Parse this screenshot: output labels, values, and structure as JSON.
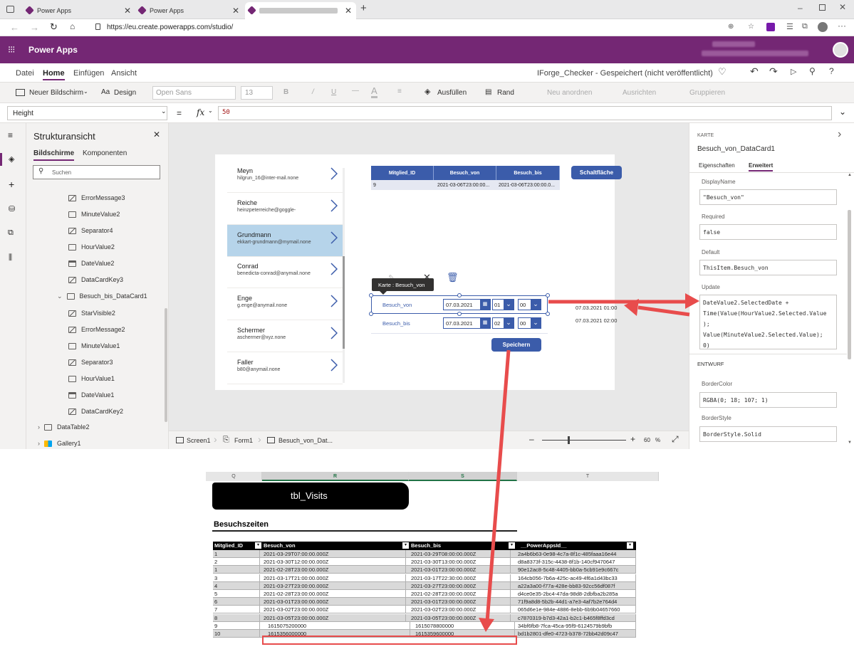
{
  "browser": {
    "tabs": [
      {
        "label": "Power Apps"
      },
      {
        "label": "Power Apps"
      },
      {
        "label": ""
      }
    ],
    "url": "https://eu.create.powerapps.com/studio/"
  },
  "app": {
    "brand": "Power Apps",
    "user_lines": [
      "",
      ""
    ]
  },
  "menu": {
    "items": [
      "Datei",
      "Home",
      "Einfügen",
      "Ansicht"
    ],
    "active": "Home",
    "status": "IForge_Checker - Gespeichert (nicht veröffentlicht)"
  },
  "toolbar": {
    "new_screen": "Neuer Bildschirm",
    "design": "Design",
    "font": "Open Sans",
    "size": "13",
    "fill": "Ausfüllen",
    "border": "Rand",
    "reorder": "Neu anordnen",
    "align": "Ausrichten",
    "group": "Gruppieren"
  },
  "formula": {
    "property": "Height",
    "fx": "fx",
    "value": "50"
  },
  "tree": {
    "title": "Strukturansicht",
    "tab_screens": "Bildschirme",
    "tab_components": "Komponenten",
    "search_placeholder": "Suchen",
    "nodes": [
      {
        "label": "ErrorMessage3",
        "icon": "edit-icon"
      },
      {
        "label": "MinuteValue2",
        "icon": "dropdown-icon"
      },
      {
        "label": "Separator4",
        "icon": "edit-icon"
      },
      {
        "label": "HourValue2",
        "icon": "dropdown-icon"
      },
      {
        "label": "DateValue2",
        "icon": "calendar-icon"
      },
      {
        "label": "DataCardKey3",
        "icon": "edit-icon"
      },
      {
        "label": "Besuch_bis_DataCard1",
        "icon": "card-icon"
      },
      {
        "label": "StarVisible2",
        "icon": "edit-icon"
      },
      {
        "label": "ErrorMessage2",
        "icon": "edit-icon"
      },
      {
        "label": "MinuteValue1",
        "icon": "dropdown-icon"
      },
      {
        "label": "Separator3",
        "icon": "edit-icon"
      },
      {
        "label": "HourValue1",
        "icon": "dropdown-icon"
      },
      {
        "label": "DateValue1",
        "icon": "calendar-icon"
      },
      {
        "label": "DataCardKey2",
        "icon": "edit-icon"
      },
      {
        "label": "DataTable2",
        "icon": "table-icon"
      },
      {
        "label": "Gallery1",
        "icon": "gallery-icon"
      }
    ]
  },
  "gallery": [
    {
      "name": "Meyn",
      "email": "hilgrun_16@inter-mail.none"
    },
    {
      "name": "Reiche",
      "email": "heinzpeterreiche@goggle-"
    },
    {
      "name": "Grundmann",
      "email": "ekkart-grundmann@mymail.none"
    },
    {
      "name": "Conrad",
      "email": "benedicta-conrad@anymail.none"
    },
    {
      "name": "Enge",
      "email": "g.enge@anymail.none"
    },
    {
      "name": "Schermer",
      "email": "aschermer@xyz.none"
    },
    {
      "name": "Faller",
      "email": "b80@anymail.none"
    }
  ],
  "datatable": {
    "headers": [
      "Mitglied_ID",
      "Besuch_von",
      "Besuch_bis"
    ],
    "row": [
      "9",
      "2021-03-06T23:00:00...",
      "2021-03-06T23:00:00.0..."
    ]
  },
  "canvas": {
    "button": "Schaltfläche",
    "tooltip": "Karte : Besuch_von",
    "field1_label": "Besuch_von",
    "field1_date": "07.03.2021",
    "field1_hour": "01",
    "field1_min": "00",
    "field2_label": "Besuch_bis",
    "field2_date": "07.03.2021",
    "field2_hour": "02",
    "field2_min": "00",
    "out1": "07.03.2021 01:00",
    "out2": "07.03.2021 02:00",
    "save": "Speichern"
  },
  "statusbar": {
    "crumbs": [
      "Screen1",
      "Form1",
      "Besuch_von_Dat..."
    ],
    "zoom": "60",
    "zoom_unit": "%"
  },
  "props": {
    "kind": "KARTE",
    "name": "Besuch_von_DataCard1",
    "tab_props": "Eigenschaften",
    "tab_adv": "Erweitert",
    "displayname_label": "DisplayName",
    "displayname": "\"Besuch_von\"",
    "required_label": "Required",
    "required": "false",
    "default_label": "Default",
    "default": "ThisItem.Besuch_von",
    "update_label": "Update",
    "update_lines": [
      "DateValue2.SelectedDate +",
      "Time(Value(HourValue2.Selected.Value",
      ");",
      "Value(MinuteValue2.Selected.Value);",
      "0)"
    ],
    "section": "ENTWURF",
    "bordercolor_label": "BorderColor",
    "bordercolor": "RGBA(0; 18; 107; 1)",
    "borderstyle_label": "BorderStyle",
    "borderstyle": "BorderStyle.Solid"
  },
  "excel": {
    "cols": [
      "Q",
      "R",
      "S",
      "T"
    ],
    "banner": "tbl_Visits",
    "heading": "Besuchszeiten",
    "headers": [
      "Mitglied_ID",
      "Besuch_von",
      "Besuch_bis",
      "__PowerAppsId__"
    ],
    "rows": [
      [
        "1",
        "2021-03-29T07:00:00.000Z",
        "2021-03-29T08:00:00.000Z",
        "2a4b6b63-0e98-4c7a-8f1c-485faaa16e44"
      ],
      [
        "2",
        "2021-03-30T12:00:00.000Z",
        "2021-03-30T13:00:00.000Z",
        "d8a8373f-315c-4438-8f1b-140cf9470647"
      ],
      [
        "1",
        "2021-02-28T23:00:00.000Z",
        "2021-03-01T23:00:00.000Z",
        "90e12ac8-5c48-4405-bb0a-5cb91e9c667c"
      ],
      [
        "3",
        "2021-03-17T21:00:00.000Z",
        "2021-03-17T22:30:00.000Z",
        "164cb056-7b6a-425c-ac49-4f6a1d43bc33"
      ],
      [
        "4",
        "2021-03-27T23:00:00.000Z",
        "2021-03-27T23:00:00.000Z",
        "a22a3a00-f77a-428e-bb83-92cc56df087f"
      ],
      [
        "5",
        "2021-02-28T23:00:00.000Z",
        "2021-02-28T23:00:00.000Z",
        "d4ce0e35-2bc4-47da-98d8-2dbfba2b285a"
      ],
      [
        "6",
        "2021-03-01T23:00:00.000Z",
        "2021-03-01T23:00:00.000Z",
        "71f9a8d8-5b2b-44d1-a7e3-4af7b2e764d4"
      ],
      [
        "7",
        "2021-03-02T23:00:00.000Z",
        "2021-03-02T23:00:00.000Z",
        "065d6e1e-984e-4886-8ebb-6b9b04657660"
      ],
      [
        "8",
        "2021-03-05T23:00:00.000Z",
        "2021-03-05T23:00:00.000Z",
        "c7870319-b7d3-42a1-b2c1-b465f8ffd3cd"
      ],
      [
        "9",
        "1615075200000",
        "1615078800000",
        "34bf6fb8-7fca-45ca-95f9-6124579b9bfb"
      ],
      [
        "10",
        "1615356000000",
        "1615359600000",
        "bd1b2801-dfe0-4723-b378-72bb42d09c47"
      ]
    ]
  },
  "colors": {
    "brand": "#742774",
    "accent": "#3b5caa",
    "arrow": "#e84c4c"
  }
}
